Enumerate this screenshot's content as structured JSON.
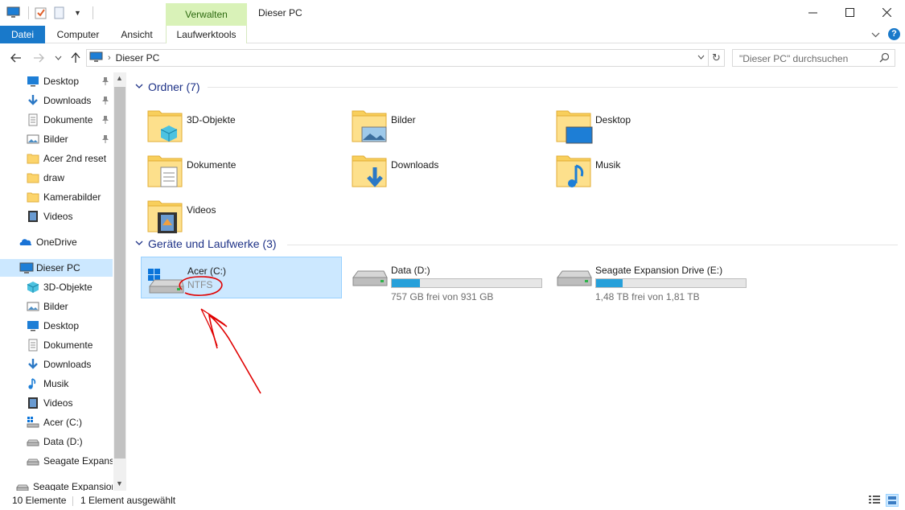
{
  "window": {
    "title": "Dieser PC",
    "context_tab_header": "Verwalten"
  },
  "ribbon": {
    "tabs": [
      "Datei",
      "Computer",
      "Ansicht",
      "Laufwerktools"
    ]
  },
  "address": {
    "path": "Dieser PC",
    "search_placeholder": "\"Dieser PC\" durchsuchen"
  },
  "sidebar": {
    "items": [
      {
        "label": "Desktop",
        "icon": "desktop-icon",
        "pinned": true
      },
      {
        "label": "Downloads",
        "icon": "downloads-icon",
        "pinned": true
      },
      {
        "label": "Dokumente",
        "icon": "documents-icon",
        "pinned": true
      },
      {
        "label": "Bilder",
        "icon": "pictures-icon",
        "pinned": true
      },
      {
        "label": "Acer 2nd reset",
        "icon": "folder-icon",
        "pinned": false
      },
      {
        "label": "draw",
        "icon": "folder-icon",
        "pinned": false
      },
      {
        "label": "Kamerabilder",
        "icon": "folder-icon",
        "pinned": false
      },
      {
        "label": "Videos",
        "icon": "videos-icon",
        "pinned": false
      },
      {
        "label": "OneDrive",
        "icon": "onedrive-icon",
        "pinned": false
      },
      {
        "label": "Dieser PC",
        "icon": "this-pc-icon",
        "pinned": false
      },
      {
        "label": "3D-Objekte",
        "icon": "3d-objects-icon",
        "pinned": false
      },
      {
        "label": "Bilder",
        "icon": "pictures-icon",
        "pinned": false
      },
      {
        "label": "Desktop",
        "icon": "desktop-icon",
        "pinned": false
      },
      {
        "label": "Dokumente",
        "icon": "documents-icon",
        "pinned": false
      },
      {
        "label": "Downloads",
        "icon": "downloads-icon",
        "pinned": false
      },
      {
        "label": "Musik",
        "icon": "music-icon",
        "pinned": false
      },
      {
        "label": "Videos",
        "icon": "videos-icon",
        "pinned": false
      },
      {
        "label": "Acer (C:)",
        "icon": "windows-drive-icon",
        "pinned": false
      },
      {
        "label": "Data (D:)",
        "icon": "drive-icon",
        "pinned": false
      },
      {
        "label": "Seagate Expansio",
        "icon": "drive-icon",
        "pinned": false
      },
      {
        "label": "Seagate Expansion",
        "icon": "drive-icon",
        "pinned": false
      }
    ]
  },
  "main": {
    "folders_heading": "Ordner (7)",
    "folders": [
      {
        "label": "3D-Objekte",
        "icon": "3d-objects-folder-icon"
      },
      {
        "label": "Bilder",
        "icon": "pictures-folder-icon"
      },
      {
        "label": "Desktop",
        "icon": "desktop-folder-icon"
      },
      {
        "label": "Dokumente",
        "icon": "documents-folder-icon"
      },
      {
        "label": "Downloads",
        "icon": "downloads-folder-icon"
      },
      {
        "label": "Musik",
        "icon": "music-folder-icon"
      },
      {
        "label": "Videos",
        "icon": "videos-folder-icon"
      }
    ],
    "devices_heading": "Geräte und Laufwerke (3)",
    "drives": [
      {
        "label": "Acer (C:)",
        "filesystem": "NTFS",
        "selected": true
      },
      {
        "label": "Data (D:)",
        "free_text": "757 GB frei von 931 GB",
        "used_fraction": 0.19
      },
      {
        "label": "Seagate Expansion Drive (E:)",
        "free_text": "1,48 TB frei von 1,81 TB",
        "used_fraction": 0.18
      }
    ]
  },
  "status": {
    "count": "10 Elemente",
    "selection": "1 Element ausgewählt"
  },
  "colors": {
    "accent": "#1979ca",
    "selection": "#cce8ff",
    "drive_bar": "#26a0da",
    "annotation": "#e00000"
  }
}
